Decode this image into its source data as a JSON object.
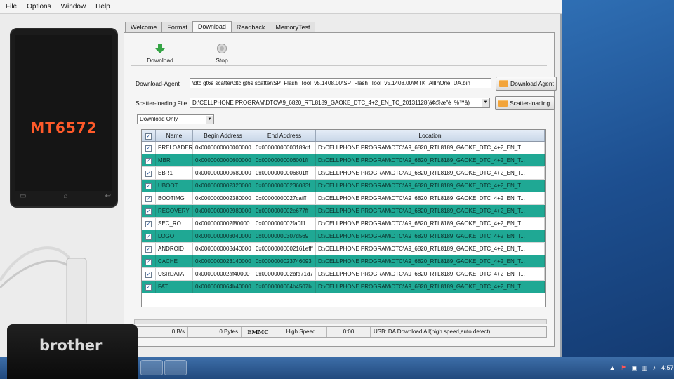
{
  "menu": [
    "File",
    "Options",
    "Window",
    "Help"
  ],
  "device": {
    "chip": "MT6572"
  },
  "tabs": [
    "Welcome",
    "Format",
    "Download",
    "Readback",
    "MemoryTest"
  ],
  "active_tab": "Download",
  "toolbar": {
    "download_label": "Download",
    "stop_label": "Stop"
  },
  "download_agent": {
    "label": "Download-Agent",
    "path": "\\dtc gt6s scatter\\dtc gt6s scatter\\SP_Flash_Tool_v5.1408.00\\SP_Flash_Tool_v5.1408.00\\MTK_AllInOne_DA.bin",
    "button_label": "Download Agent"
  },
  "scatter": {
    "label": "Scatter-loading File",
    "path": "D:\\CELLPHONE PROGRAM\\DTC\\A9_6820_RTL8189_GAOKE_DTC_4+2_EN_TC_20131128(ä¢@æ\"è¯%™å)",
    "button_label": "Scatter-loading"
  },
  "mode": "Download Only",
  "table": {
    "columns": [
      "Name",
      "Begin Address",
      "End Address",
      "Location"
    ],
    "rows": [
      {
        "name": "PRELOADER",
        "begin": "0x0000000000000000",
        "end": "0x00000000000189df",
        "location": "D:\\CELLPHONE PROGRAM\\DTC\\A9_6820_RTL8189_GAOKE_DTC_4+2_EN_T..."
      },
      {
        "name": "MBR",
        "begin": "0x0000000000600000",
        "end": "0x00000000006001ff",
        "location": "D:\\CELLPHONE PROGRAM\\DTC\\A9_6820_RTL8189_GAOKE_DTC_4+2_EN_T..."
      },
      {
        "name": "EBR1",
        "begin": "0x0000000000680000",
        "end": "0x00000000006801ff",
        "location": "D:\\CELLPHONE PROGRAM\\DTC\\A9_6820_RTL8189_GAOKE_DTC_4+2_EN_T..."
      },
      {
        "name": "UBOOT",
        "begin": "0x0000000002320000",
        "end": "0x000000000236083f",
        "location": "D:\\CELLPHONE PROGRAM\\DTC\\A9_6820_RTL8189_GAOKE_DTC_4+2_EN_T..."
      },
      {
        "name": "BOOTIMG",
        "begin": "0x0000000002380000",
        "end": "0x00000000027cafff",
        "location": "D:\\CELLPHONE PROGRAM\\DTC\\A9_6820_RTL8189_GAOKE_DTC_4+2_EN_T..."
      },
      {
        "name": "RECOVERY",
        "begin": "0x0000000002980000",
        "end": "0x0000000002e677ff",
        "location": "D:\\CELLPHONE PROGRAM\\DTC\\A9_6820_RTL8189_GAOKE_DTC_4+2_EN_T..."
      },
      {
        "name": "SEC_RO",
        "begin": "0x0000000002f80000",
        "end": "0x0000000002fa0fff",
        "location": "D:\\CELLPHONE PROGRAM\\DTC\\A9_6820_RTL8189_GAOKE_DTC_4+2_EN_T..."
      },
      {
        "name": "LOGO",
        "begin": "0x0000000003040000",
        "end": "0x00000000307d569",
        "location": "D:\\CELLPHONE PROGRAM\\DTC\\A9_6820_RTL8189_GAOKE_DTC_4+2_EN_T..."
      },
      {
        "name": "ANDROID",
        "begin": "0x0000000003d40000",
        "end": "0x00000000002161efff",
        "location": "D:\\CELLPHONE PROGRAM\\DTC\\A9_6820_RTL8189_GAOKE_DTC_4+2_EN_T..."
      },
      {
        "name": "CACHE",
        "begin": "0x0000000023140000",
        "end": "0x0000000023746093",
        "location": "D:\\CELLPHONE PROGRAM\\DTC\\A9_6820_RTL8189_GAOKE_DTC_4+2_EN_T..."
      },
      {
        "name": "USRDATA",
        "begin": "0x000000002af40000",
        "end": "0x0000000002bfd71d7",
        "location": "D:\\CELLPHONE PROGRAM\\DTC\\A9_6820_RTL8189_GAOKE_DTC_4+2_EN_T..."
      },
      {
        "name": "FAT",
        "begin": "0x0000000064b40000",
        "end": "0x0000000064b4507b",
        "location": "D:\\CELLPHONE PROGRAM\\DTC\\A9_6820_RTL8189_GAOKE_DTC_4+2_EN_T..."
      }
    ]
  },
  "status": {
    "speed": "0 B/s",
    "bytes": "0 Bytes",
    "storage": "EMMC",
    "speed_mode": "High Speed",
    "time": "0:00",
    "usb": "USB: DA Download All(high speed,auto detect)"
  },
  "taskbar": {
    "clock": "4:57"
  },
  "printer": {
    "brand": "brother"
  },
  "colors": {
    "row_highlight": "#1fa894",
    "chip_text": "#ff5a2a",
    "taskbar": "#2c5a93"
  }
}
